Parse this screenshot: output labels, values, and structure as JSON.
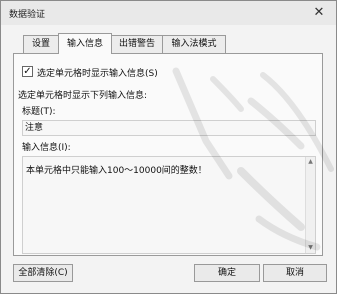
{
  "dialog": {
    "title": "数据验证",
    "close_glyph": "✕"
  },
  "tabs": [
    {
      "label": "设置",
      "active": false
    },
    {
      "label": "输入信息",
      "active": true
    },
    {
      "label": "出错警告",
      "active": false
    },
    {
      "label": "输入法模式",
      "active": false
    }
  ],
  "input_message": {
    "show_checkbox_label": "选定单元格时显示输入信息(S)",
    "show_checked": true,
    "section_label": "选定单元格时显示下列输入信息:",
    "title_label": "标题(T):",
    "title_value": "注意",
    "message_label": "输入信息(I):",
    "message_value": "本单元格中只能输入100～10000间的整数！"
  },
  "buttons": {
    "clear_all": "全部清除(C)",
    "ok": "确定",
    "cancel": "取消"
  },
  "icons": {
    "checkbox_mark": "✓",
    "scroll_up": "▲",
    "scroll_down": "▼"
  }
}
